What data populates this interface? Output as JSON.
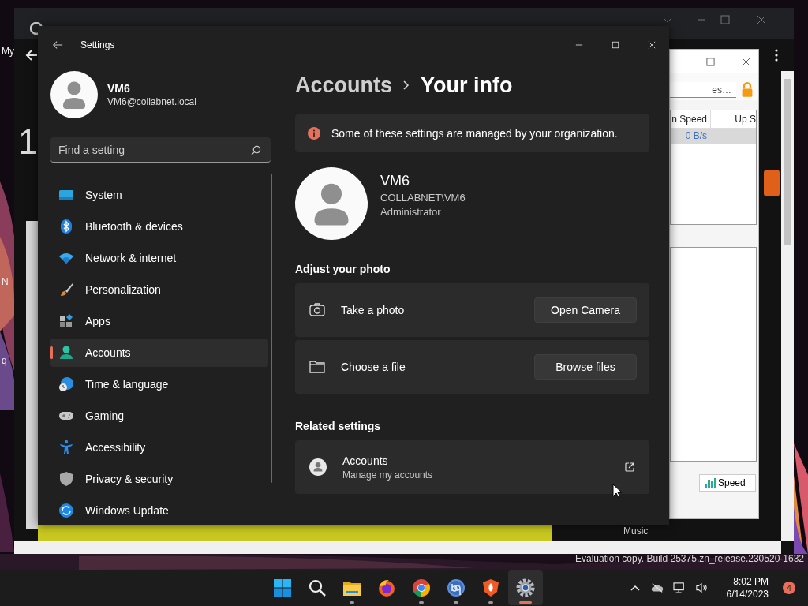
{
  "desktop": {
    "icon_labels": [
      "My",
      "N",
      "q"
    ]
  },
  "browser": {
    "content_digit": "1",
    "partial_text": "Music"
  },
  "torrent_window": {
    "search_value": "es…",
    "columns": [
      "n Speed",
      "Up S"
    ],
    "rows": [
      {
        "down_speed": "0 B/s",
        "selected": true
      }
    ],
    "speed_button": "Speed"
  },
  "settings": {
    "title": "Settings",
    "user": {
      "name": "VM6",
      "email": "VM6@collabnet.local"
    },
    "search": {
      "placeholder": "Find a setting"
    },
    "nav": [
      {
        "label": "System",
        "selected": false
      },
      {
        "label": "Bluetooth & devices",
        "selected": false
      },
      {
        "label": "Network & internet",
        "selected": false
      },
      {
        "label": "Personalization",
        "selected": false
      },
      {
        "label": "Apps",
        "selected": false
      },
      {
        "label": "Accounts",
        "selected": true
      },
      {
        "label": "Time & language",
        "selected": false
      },
      {
        "label": "Gaming",
        "selected": false
      },
      {
        "label": "Accessibility",
        "selected": false
      },
      {
        "label": "Privacy & security",
        "selected": false
      },
      {
        "label": "Windows Update",
        "selected": false
      }
    ],
    "breadcrumb": [
      "Accounts",
      "Your info"
    ],
    "notice": "Some of these settings are managed by your organization.",
    "profile": {
      "name": "VM6",
      "account": "COLLABNET\\VM6",
      "role": "Administrator"
    },
    "photo_section": {
      "heading": "Adjust your photo",
      "options": [
        {
          "kind": "camera",
          "label": "Take a photo",
          "button": "Open Camera"
        },
        {
          "kind": "file",
          "label": "Choose a file",
          "button": "Browse files"
        }
      ]
    },
    "related": {
      "heading": "Related settings",
      "links": [
        {
          "title": "Accounts",
          "subtitle": "Manage my accounts"
        }
      ]
    }
  },
  "build_notice": "Evaluation copy. Build 25375.zn_release.230520-1632",
  "taskbar": {
    "apps": [
      {
        "running": false,
        "active": false
      },
      {
        "running": false,
        "active": false
      },
      {
        "running": true,
        "active": false
      },
      {
        "running": false,
        "active": false
      },
      {
        "running": true,
        "active": false
      },
      {
        "running": true,
        "active": false
      },
      {
        "running": true,
        "active": false
      },
      {
        "running": true,
        "active": true
      }
    ],
    "clock": {
      "time": "8:02 PM",
      "date": "6/14/2023"
    },
    "notifications": "4"
  }
}
